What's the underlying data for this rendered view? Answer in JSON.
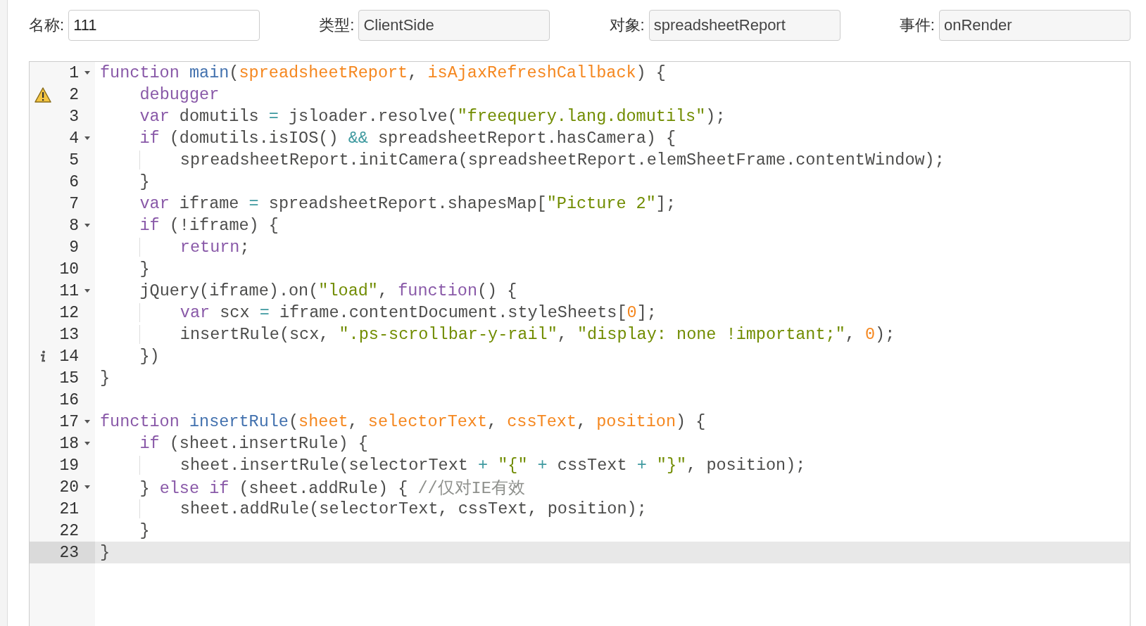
{
  "fields": [
    {
      "label": "名称:",
      "value": "111",
      "disabled": false
    },
    {
      "label": "类型:",
      "value": "ClientSide",
      "disabled": true
    },
    {
      "label": "对象:",
      "value": "spreadsheetReport",
      "disabled": true
    },
    {
      "label": "事件:",
      "value": "onRender",
      "disabled": true
    }
  ],
  "editor": {
    "lines": [
      {
        "number": "1",
        "fold": true,
        "active": false,
        "warning": false,
        "info": false,
        "text": "function main(spreadsheetReport, isAjaxRefreshCallback) {"
      },
      {
        "number": "2",
        "fold": false,
        "active": false,
        "warning": true,
        "info": false,
        "text": "    debugger"
      },
      {
        "number": "3",
        "fold": false,
        "active": false,
        "warning": false,
        "info": false,
        "text": "    var domutils = jsloader.resolve(\"freequery.lang.domutils\");"
      },
      {
        "number": "4",
        "fold": true,
        "active": false,
        "warning": false,
        "info": false,
        "text": "    if (domutils.isIOS() && spreadsheetReport.hasCamera) {"
      },
      {
        "number": "5",
        "fold": false,
        "active": false,
        "warning": false,
        "info": false,
        "text": "        spreadsheetReport.initCamera(spreadsheetReport.elemSheetFrame.contentWindow);"
      },
      {
        "number": "6",
        "fold": false,
        "active": false,
        "warning": false,
        "info": false,
        "text": "    }"
      },
      {
        "number": "7",
        "fold": false,
        "active": false,
        "warning": false,
        "info": false,
        "text": "    var iframe = spreadsheetReport.shapesMap[\"Picture 2\"];"
      },
      {
        "number": "8",
        "fold": true,
        "active": false,
        "warning": false,
        "info": false,
        "text": "    if (!iframe) {"
      },
      {
        "number": "9",
        "fold": false,
        "active": false,
        "warning": false,
        "info": false,
        "text": "        return;"
      },
      {
        "number": "10",
        "fold": false,
        "active": false,
        "warning": false,
        "info": false,
        "text": "    }"
      },
      {
        "number": "11",
        "fold": true,
        "active": false,
        "warning": false,
        "info": false,
        "text": "    jQuery(iframe).on(\"load\", function() {"
      },
      {
        "number": "12",
        "fold": false,
        "active": false,
        "warning": false,
        "info": false,
        "text": "        var scx = iframe.contentDocument.styleSheets[0];"
      },
      {
        "number": "13",
        "fold": false,
        "active": false,
        "warning": false,
        "info": false,
        "text": "        insertRule(scx, \".ps-scrollbar-y-rail\", \"display: none !important;\", 0);"
      },
      {
        "number": "14",
        "fold": false,
        "active": false,
        "warning": false,
        "info": true,
        "text": "    })"
      },
      {
        "number": "15",
        "fold": false,
        "active": false,
        "warning": false,
        "info": false,
        "text": "}"
      },
      {
        "number": "16",
        "fold": false,
        "active": false,
        "warning": false,
        "info": false
      },
      {
        "number": "17",
        "fold": true,
        "active": false,
        "warning": false,
        "info": false,
        "text": "function insertRule(sheet, selectorText, cssText, position) {"
      },
      {
        "number": "18",
        "fold": true,
        "active": false,
        "warning": false,
        "info": false,
        "text": "    if (sheet.insertRule) {"
      },
      {
        "number": "19",
        "fold": false,
        "active": false,
        "warning": false,
        "info": false,
        "text": "        sheet.insertRule(selectorText + \"{\" + cssText + \"}\", position);"
      },
      {
        "number": "20",
        "fold": true,
        "active": false,
        "warning": false,
        "info": false,
        "text": "    } else if (sheet.addRule) { //仅对IE有效"
      },
      {
        "number": "21",
        "fold": false,
        "active": false,
        "warning": false,
        "info": false,
        "text": "        sheet.addRule(selectorText, cssText, position);"
      },
      {
        "number": "22",
        "fold": false,
        "active": false,
        "warning": false,
        "info": false,
        "text": "    }"
      },
      {
        "number": "23",
        "fold": false,
        "active": true,
        "warning": false,
        "info": false,
        "text": "}"
      }
    ]
  }
}
